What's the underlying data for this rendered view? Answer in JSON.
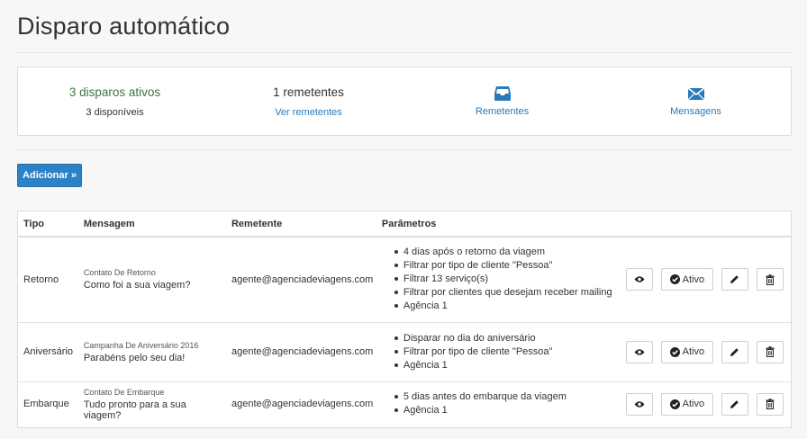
{
  "page": {
    "title": "Disparo automático"
  },
  "stats": {
    "active": {
      "count_label": "3 disparos ativos",
      "available_label": "3 disponíveis"
    },
    "senders": {
      "count_label": "1 remetentes",
      "link_label": "Ver remetentes"
    },
    "remetentes_link": {
      "label": "Remetentes",
      "icon": "inbox-icon"
    },
    "mensagens_link": {
      "label": "Mensagens",
      "icon": "envelope-icon"
    }
  },
  "toolbar": {
    "add_label": "Adicionar »"
  },
  "table": {
    "headers": [
      "Tipo",
      "Mensagem",
      "Remetente",
      "Parâmetros"
    ],
    "rows": [
      {
        "tipo": "Retorno",
        "campaign": "Contato De Retorno",
        "message": "Como foi a sua viagem?",
        "sender": "agente@agenciadeviagens.com",
        "params": [
          "4 dias após o retorno da viagem",
          "Filtrar por tipo de cliente \"Pessoa\"",
          "Filtrar 13 serviço(s)",
          "Filtrar por clientes que desejam receber mailing",
          "Agência 1"
        ],
        "status_label": "Ativo"
      },
      {
        "tipo": "Aniversário",
        "campaign": "Campanha De Aniversário 2016",
        "message": "Parabéns pelo seu dia!",
        "sender": "agente@agenciadeviagens.com",
        "params": [
          "Disparar no dia do aniversário",
          "Filtrar por tipo de cliente \"Pessoa\"",
          "Agência 1"
        ],
        "status_label": "Ativo"
      },
      {
        "tipo": "Embarque",
        "campaign": "Contato De Embarque",
        "message": "Tudo pronto para a sua viagem?",
        "sender": "agente@agenciadeviagens.com",
        "params": [
          "5 dias antes do embarque da viagem",
          "Agência 1"
        ],
        "status_label": "Ativo"
      }
    ]
  },
  "colors": {
    "accent": "#2d81c5",
    "link": "#2a7ab8",
    "success_text": "#3c763d"
  }
}
